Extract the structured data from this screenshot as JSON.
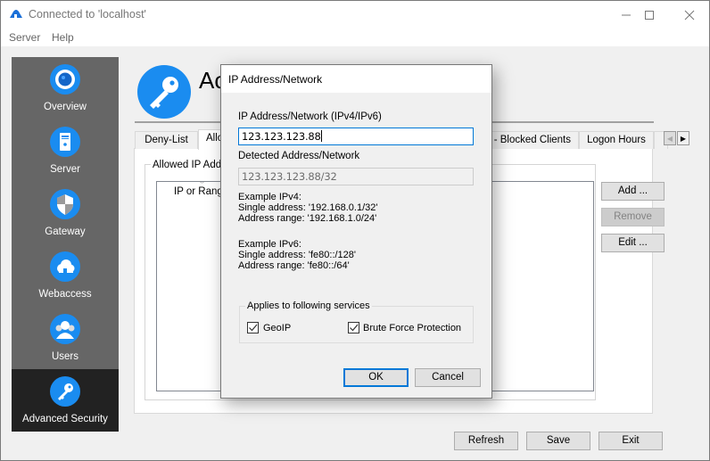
{
  "window": {
    "title": "Connected to 'localhost'",
    "controls": {
      "minimize": "—",
      "maximize": "☐",
      "close": "✕"
    }
  },
  "menu": {
    "items": [
      "Server",
      "Help"
    ]
  },
  "sidebar": {
    "items": [
      {
        "label": "Overview",
        "icon": "overview-icon",
        "active": false
      },
      {
        "label": "Server",
        "icon": "server-icon",
        "active": false
      },
      {
        "label": "Gateway",
        "icon": "gateway-shield-icon",
        "active": false
      },
      {
        "label": "Webaccess",
        "icon": "cloud-icon",
        "active": false
      },
      {
        "label": "Users",
        "icon": "users-icon",
        "active": false
      },
      {
        "label": "Advanced Security",
        "icon": "key-icon",
        "active": true
      }
    ]
  },
  "page": {
    "title": "Advanced Security",
    "title_visible": "Ac",
    "tabs": [
      {
        "label": "Deny-List",
        "selected": false
      },
      {
        "label": "Allowed IP Addresses",
        "label_visible": "Allo",
        "selected": true
      },
      {
        "label": "IP - Blocked Clients",
        "label_visible": "P - Blocked Clients",
        "selected": false
      },
      {
        "label": "Logon Hours",
        "selected": false
      }
    ],
    "groupbox_title": "Allowed  IP Add",
    "list_column": "IP or Rang",
    "side_buttons": {
      "add": "Add ...",
      "remove": "Remove",
      "edit": "Edit ..."
    },
    "footer_buttons": {
      "refresh": "Refresh",
      "save": "Save",
      "exit": "Exit"
    }
  },
  "dialog": {
    "title": "IP Address/Network",
    "ip_label": "IP Address/Network (IPv4/IPv6)",
    "ip_value": "123.123.123.88",
    "detected_label": "Detected Address/Network",
    "detected_value": "123.123.123.88/32",
    "example_ipv4": [
      "Example IPv4:",
      "Single address: '192.168.0.1/32'",
      "Address range: '192.168.1.0/24'"
    ],
    "example_ipv6": [
      "Example IPv6:",
      "Single address: 'fe80::/128'",
      "Address range: 'fe80::/64'"
    ],
    "services_title": "Applies to following services",
    "services": [
      {
        "label": "GeoIP",
        "checked": true
      },
      {
        "label": "Brute Force Protection",
        "checked": true
      }
    ],
    "ok": "OK",
    "cancel": "Cancel"
  },
  "colors": {
    "accent": "#1a8cf0",
    "focus": "#0078d7",
    "sidebar_bg": "#666666",
    "sidebar_active": "#222222"
  }
}
